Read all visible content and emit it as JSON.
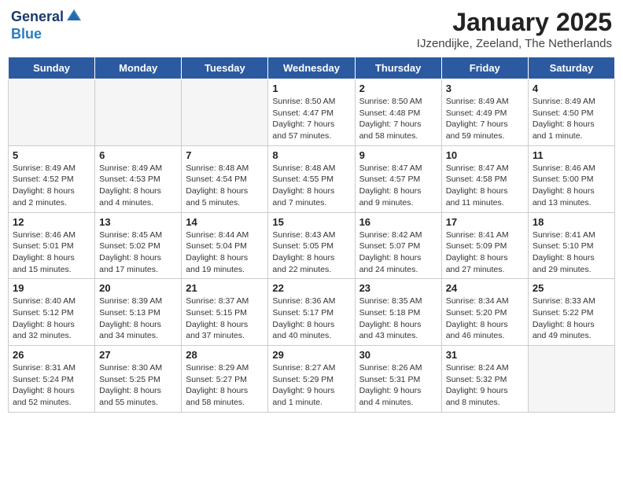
{
  "logo": {
    "line1": "General",
    "line2": "Blue"
  },
  "title": "January 2025",
  "subtitle": "IJzendijke, Zeeland, The Netherlands",
  "headers": [
    "Sunday",
    "Monday",
    "Tuesday",
    "Wednesday",
    "Thursday",
    "Friday",
    "Saturday"
  ],
  "weeks": [
    [
      {
        "day": "",
        "text": ""
      },
      {
        "day": "",
        "text": ""
      },
      {
        "day": "",
        "text": ""
      },
      {
        "day": "1",
        "text": "Sunrise: 8:50 AM\nSunset: 4:47 PM\nDaylight: 7 hours\nand 57 minutes."
      },
      {
        "day": "2",
        "text": "Sunrise: 8:50 AM\nSunset: 4:48 PM\nDaylight: 7 hours\nand 58 minutes."
      },
      {
        "day": "3",
        "text": "Sunrise: 8:49 AM\nSunset: 4:49 PM\nDaylight: 7 hours\nand 59 minutes."
      },
      {
        "day": "4",
        "text": "Sunrise: 8:49 AM\nSunset: 4:50 PM\nDaylight: 8 hours\nand 1 minute."
      }
    ],
    [
      {
        "day": "5",
        "text": "Sunrise: 8:49 AM\nSunset: 4:52 PM\nDaylight: 8 hours\nand 2 minutes."
      },
      {
        "day": "6",
        "text": "Sunrise: 8:49 AM\nSunset: 4:53 PM\nDaylight: 8 hours\nand 4 minutes."
      },
      {
        "day": "7",
        "text": "Sunrise: 8:48 AM\nSunset: 4:54 PM\nDaylight: 8 hours\nand 5 minutes."
      },
      {
        "day": "8",
        "text": "Sunrise: 8:48 AM\nSunset: 4:55 PM\nDaylight: 8 hours\nand 7 minutes."
      },
      {
        "day": "9",
        "text": "Sunrise: 8:47 AM\nSunset: 4:57 PM\nDaylight: 8 hours\nand 9 minutes."
      },
      {
        "day": "10",
        "text": "Sunrise: 8:47 AM\nSunset: 4:58 PM\nDaylight: 8 hours\nand 11 minutes."
      },
      {
        "day": "11",
        "text": "Sunrise: 8:46 AM\nSunset: 5:00 PM\nDaylight: 8 hours\nand 13 minutes."
      }
    ],
    [
      {
        "day": "12",
        "text": "Sunrise: 8:46 AM\nSunset: 5:01 PM\nDaylight: 8 hours\nand 15 minutes."
      },
      {
        "day": "13",
        "text": "Sunrise: 8:45 AM\nSunset: 5:02 PM\nDaylight: 8 hours\nand 17 minutes."
      },
      {
        "day": "14",
        "text": "Sunrise: 8:44 AM\nSunset: 5:04 PM\nDaylight: 8 hours\nand 19 minutes."
      },
      {
        "day": "15",
        "text": "Sunrise: 8:43 AM\nSunset: 5:05 PM\nDaylight: 8 hours\nand 22 minutes."
      },
      {
        "day": "16",
        "text": "Sunrise: 8:42 AM\nSunset: 5:07 PM\nDaylight: 8 hours\nand 24 minutes."
      },
      {
        "day": "17",
        "text": "Sunrise: 8:41 AM\nSunset: 5:09 PM\nDaylight: 8 hours\nand 27 minutes."
      },
      {
        "day": "18",
        "text": "Sunrise: 8:41 AM\nSunset: 5:10 PM\nDaylight: 8 hours\nand 29 minutes."
      }
    ],
    [
      {
        "day": "19",
        "text": "Sunrise: 8:40 AM\nSunset: 5:12 PM\nDaylight: 8 hours\nand 32 minutes."
      },
      {
        "day": "20",
        "text": "Sunrise: 8:39 AM\nSunset: 5:13 PM\nDaylight: 8 hours\nand 34 minutes."
      },
      {
        "day": "21",
        "text": "Sunrise: 8:37 AM\nSunset: 5:15 PM\nDaylight: 8 hours\nand 37 minutes."
      },
      {
        "day": "22",
        "text": "Sunrise: 8:36 AM\nSunset: 5:17 PM\nDaylight: 8 hours\nand 40 minutes."
      },
      {
        "day": "23",
        "text": "Sunrise: 8:35 AM\nSunset: 5:18 PM\nDaylight: 8 hours\nand 43 minutes."
      },
      {
        "day": "24",
        "text": "Sunrise: 8:34 AM\nSunset: 5:20 PM\nDaylight: 8 hours\nand 46 minutes."
      },
      {
        "day": "25",
        "text": "Sunrise: 8:33 AM\nSunset: 5:22 PM\nDaylight: 8 hours\nand 49 minutes."
      }
    ],
    [
      {
        "day": "26",
        "text": "Sunrise: 8:31 AM\nSunset: 5:24 PM\nDaylight: 8 hours\nand 52 minutes."
      },
      {
        "day": "27",
        "text": "Sunrise: 8:30 AM\nSunset: 5:25 PM\nDaylight: 8 hours\nand 55 minutes."
      },
      {
        "day": "28",
        "text": "Sunrise: 8:29 AM\nSunset: 5:27 PM\nDaylight: 8 hours\nand 58 minutes."
      },
      {
        "day": "29",
        "text": "Sunrise: 8:27 AM\nSunset: 5:29 PM\nDaylight: 9 hours\nand 1 minute."
      },
      {
        "day": "30",
        "text": "Sunrise: 8:26 AM\nSunset: 5:31 PM\nDaylight: 9 hours\nand 4 minutes."
      },
      {
        "day": "31",
        "text": "Sunrise: 8:24 AM\nSunset: 5:32 PM\nDaylight: 9 hours\nand 8 minutes."
      },
      {
        "day": "",
        "text": ""
      }
    ]
  ]
}
